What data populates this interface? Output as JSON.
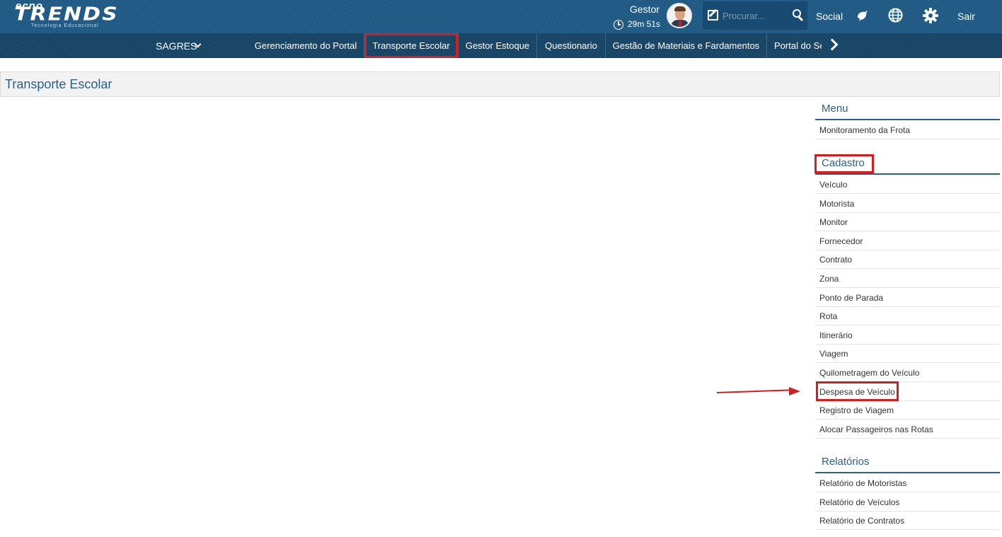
{
  "header": {
    "logo_top": "ecno",
    "logo_main": "TRENDS",
    "logo_sub": "Tecnologia Educacional",
    "user_name": "Gestor",
    "session_timer": "29m 51s",
    "search_placeholder": "Procurar...",
    "social_label": "Social",
    "logout_label": "Sair",
    "icons": [
      "clock-icon",
      "avatar",
      "edit-icon",
      "search-icon",
      "bird-icon",
      "globe-icon",
      "gear-icon"
    ]
  },
  "nav": {
    "system": "SAGRES",
    "items": [
      {
        "label": "Gerenciamento do Portal"
      },
      {
        "label": "Transporte Escolar",
        "active": true
      },
      {
        "label": "Gestor Estoque"
      },
      {
        "label": "Questionario"
      },
      {
        "label": "Gestão de Materiais e Fardamentos"
      },
      {
        "label": "Portal do Se"
      }
    ]
  },
  "page": {
    "title": "Transporte Escolar"
  },
  "side_menu": {
    "menu": {
      "title": "Menu",
      "items": [
        "Monitoramento da Frota"
      ]
    },
    "cadastro": {
      "title": "Cadastro",
      "items": [
        "Veículo",
        "Motorista",
        "Monitor",
        "Fornecedor",
        "Contrato",
        "Zona",
        "Ponto de Parada",
        "Rota",
        "Itinerário",
        "Viagem",
        "Quilometragem do Veículo",
        "Despesa de Veículo",
        "Registro de Viagem",
        "Alocar Passageiros nas Rotas"
      ]
    },
    "relatorios": {
      "title": "Relatórios",
      "items": [
        "Relatório de Motoristas",
        "Relatório de Veículos",
        "Relatório de Contratos"
      ]
    }
  },
  "colors": {
    "topbar": "#1f5a86",
    "navbar": "#174566",
    "accent": "#2b5f8a",
    "highlight": "#d71c20"
  }
}
